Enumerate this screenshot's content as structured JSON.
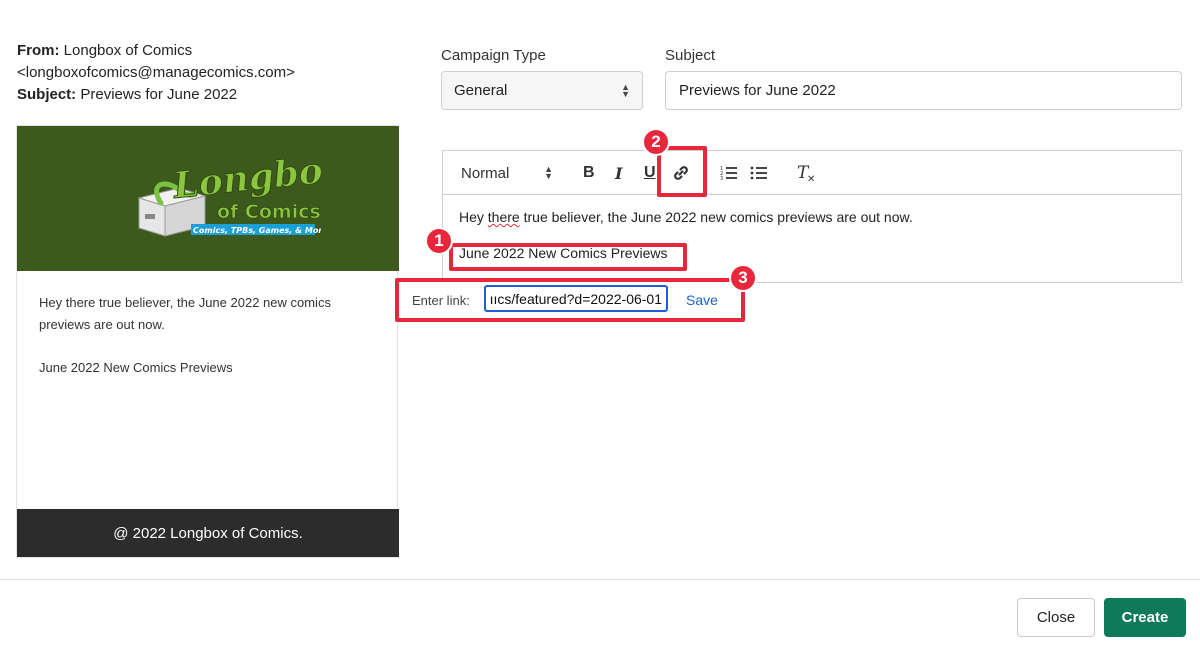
{
  "email_header": {
    "from_label": "From:",
    "from_value": "Longbox of Comics",
    "from_email": "<longboxofcomics@managecomics.com>",
    "subject_label": "Subject:",
    "subject_value": "Previews for June 2022"
  },
  "preview": {
    "logo": {
      "title_line1": "Longbox",
      "title_line2": "of Comics",
      "tagline": "Comics, TPBs, Games, & More"
    },
    "body_line1": "Hey there true believer, the June 2022 new comics previews are out now.",
    "body_line2": "June 2022 New Comics Previews",
    "footer": "@ 2022 Longbox of Comics."
  },
  "form": {
    "campaign_type_label": "Campaign Type",
    "campaign_type_value": "General",
    "subject_label": "Subject",
    "subject_value": "Previews for June 2022"
  },
  "toolbar": {
    "format_value": "Normal",
    "bold": "B",
    "italic": "I",
    "underline": "U",
    "clean": "T"
  },
  "editor": {
    "line1_pre": "Hey ",
    "line1_spell": "there",
    "line1_post": " true believer, the June 2022 new comics previews are out now.",
    "line2": "June 2022 New Comics Previews"
  },
  "link_tooltip": {
    "label": "Enter link:",
    "value": "ııcs/featured?d=2022-06-01",
    "save": "Save"
  },
  "callouts": [
    "1",
    "2",
    "3"
  ],
  "footer": {
    "close": "Close",
    "create": "Create"
  },
  "colors": {
    "highlight": "#e8273c",
    "create_button": "#0e7a5a",
    "banner": "#3c5a1b",
    "link": "#1e62c8"
  }
}
